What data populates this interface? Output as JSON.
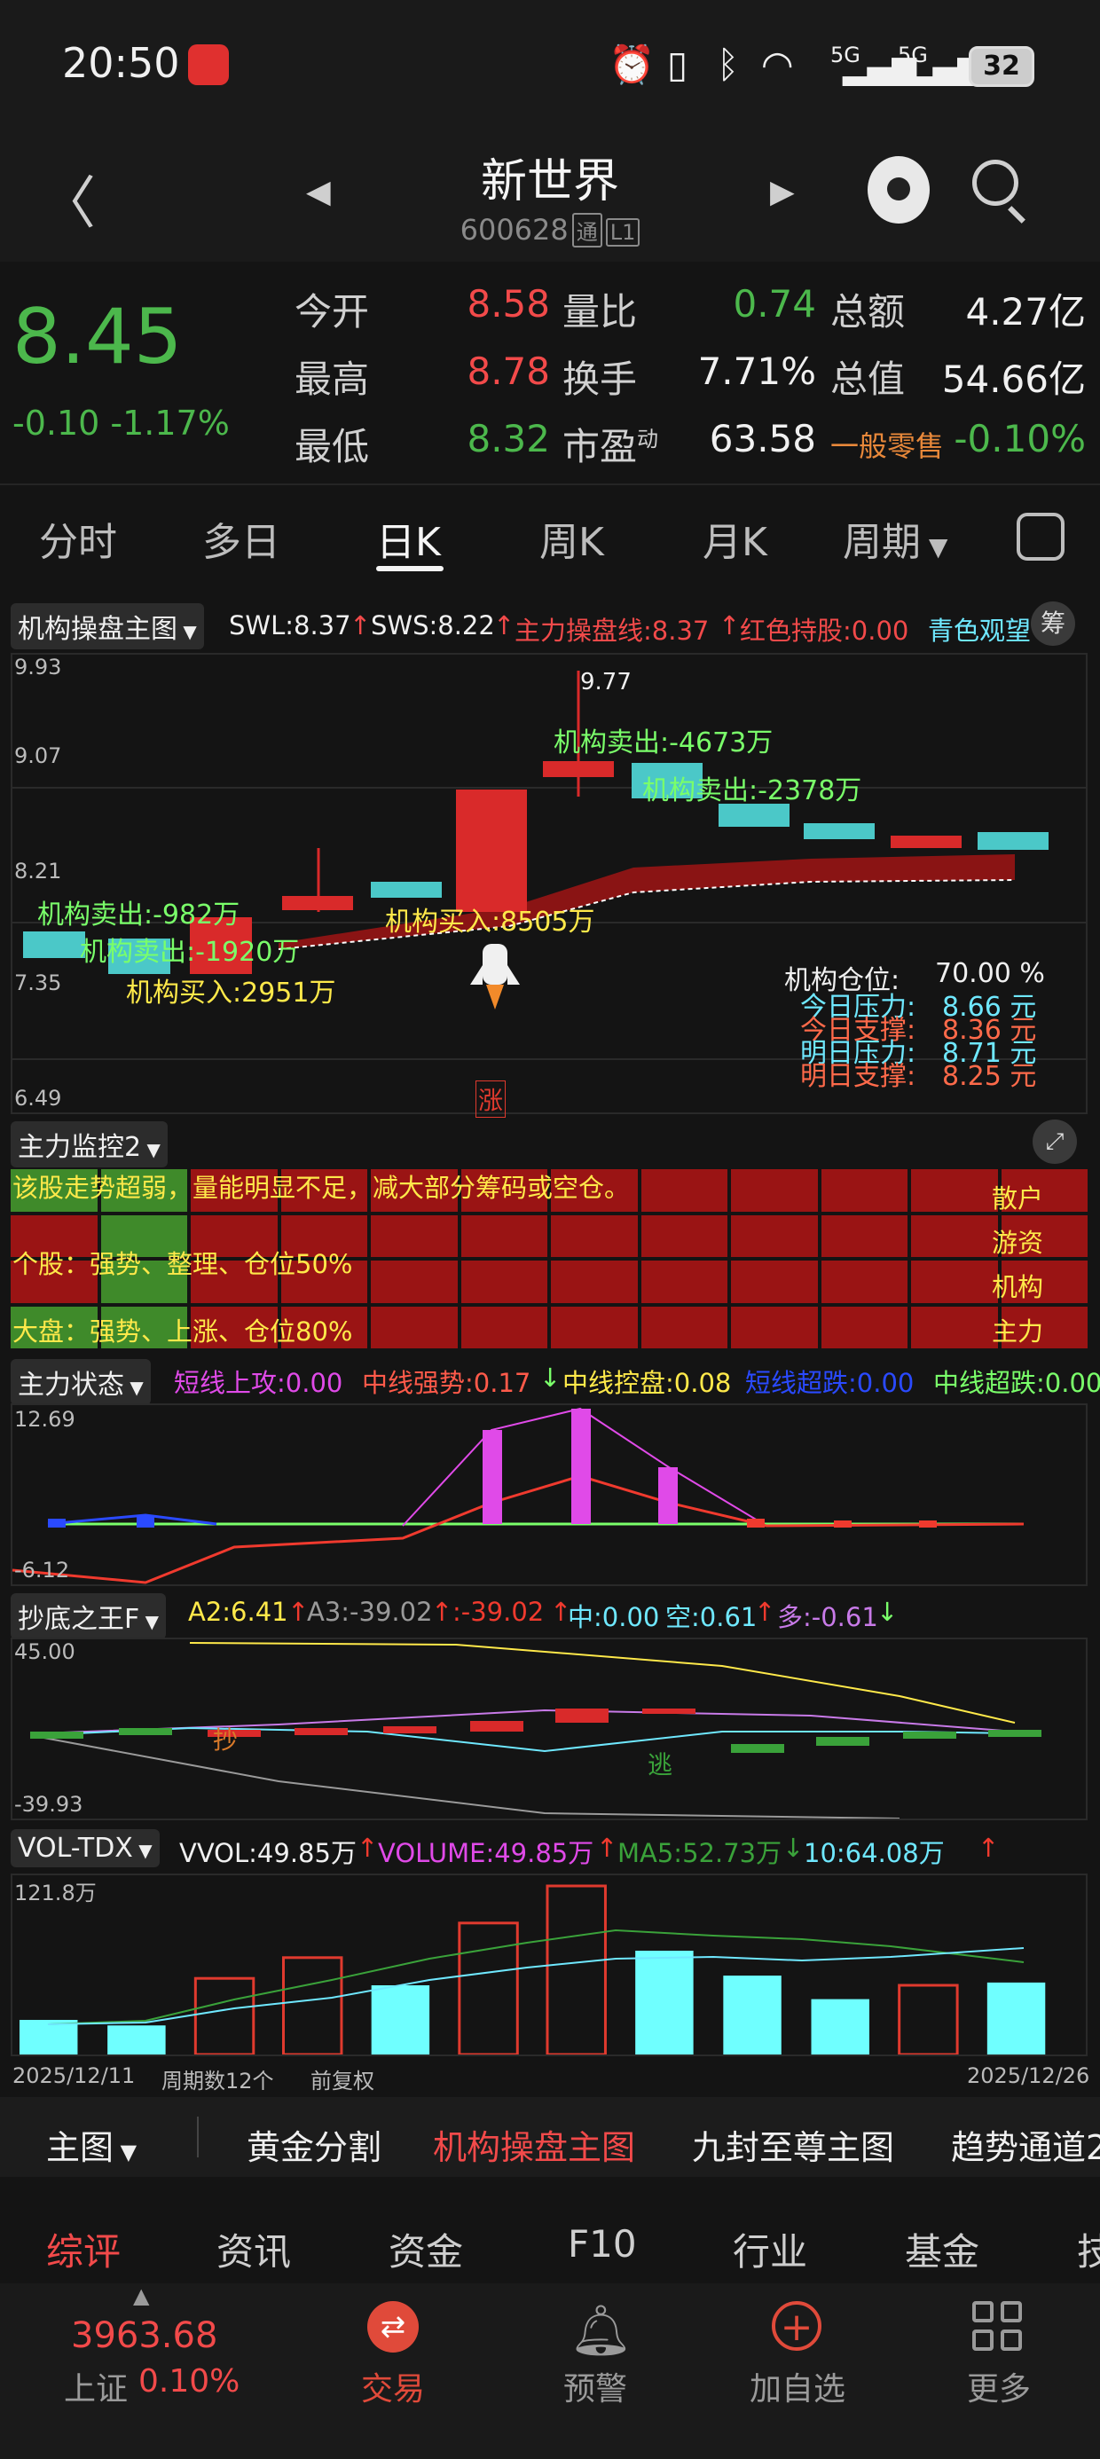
{
  "status_bar": {
    "time": "20:50",
    "network_a": "5G",
    "network_b": "5G",
    "battery": "32"
  },
  "header": {
    "stock_name": "新世界",
    "stock_code": "600628",
    "tag_tong": "通",
    "tag_l1": "L1"
  },
  "quote": {
    "price": "8.45",
    "change": "-0.10 -1.17%",
    "rows": [
      {
        "l1": "今开",
        "v1": "8.58",
        "l2": "量比",
        "v2": "0.74",
        "l3": "总额",
        "v3": "4.27亿"
      },
      {
        "l1": "最高",
        "v1": "8.78",
        "l2": "换手",
        "v2": "7.71%",
        "l3": "总值",
        "v3": "54.66亿"
      },
      {
        "l1": "最低",
        "v1": "8.32",
        "l2": "市盈",
        "l2_sup": "动",
        "v2": "63.58",
        "l3": "一般零售",
        "v3": "-0.10%"
      }
    ]
  },
  "tabs": [
    "分时",
    "多日",
    "日K",
    "周K",
    "月K",
    "周期"
  ],
  "main_chart": {
    "name": "机构操盘主图",
    "indicators": {
      "swl": "SWL:8.37",
      "sws": "SWS:8.22",
      "zl": "主力操盘线:8.37",
      "hs": "红色持股:0.00",
      "qs": "青色观望"
    },
    "chip_button": "筹",
    "y_ticks": [
      "9.93",
      "9.07",
      "8.21",
      "7.35",
      "6.49"
    ],
    "high_label": "9.77",
    "annotations": [
      "机构卖出:-4673万",
      "机构卖出:-2378万",
      "机构卖出:-982万",
      "机构卖出:-1920万",
      "机构买入:2951万",
      "机构买入:8505万"
    ],
    "limit_up_mark": "涨",
    "position": {
      "label": "机构仓位:",
      "value": "70.00 %"
    },
    "levels": [
      {
        "label": "今日压力:",
        "value": "8.66 元"
      },
      {
        "label": "今日支撑:",
        "value": "8.36 元"
      },
      {
        "label": "明日压力:",
        "value": "8.71 元"
      },
      {
        "label": "明日支撑:",
        "value": "8.25 元"
      }
    ]
  },
  "monitor": {
    "name": "主力监控2",
    "line1": "该股走势超弱，量能明显不足，减大部分筹码或空仓。",
    "line2": "个股：强势、整理、仓位50%",
    "line3": "大盘：强势、上涨、仓位80%",
    "side_labels": [
      "散户",
      "游资",
      "机构",
      "主力"
    ]
  },
  "state_panel": {
    "name": "主力状态",
    "values": {
      "a": "短线上攻:0.00",
      "b": "中线强势:0.17",
      "c": "中线控盘:0.08",
      "d": "短线超跌:0.00",
      "e": "中线超跌:0.00"
    },
    "y_top": "12.69",
    "y_bottom": "-6.12"
  },
  "bottom_panel": {
    "name": "抄底之王F",
    "values": {
      "a2": "A2:6.41",
      "a3": "A3:-39.02",
      "c": ":-39.02",
      "z": "中:0.00",
      "k": "空:0.61",
      "d": "多:-0.61"
    },
    "y_top": "45.00",
    "y_bottom": "-39.93",
    "mark_buy": "抄",
    "mark_escape": "逃"
  },
  "volume_panel": {
    "name": "VOL-TDX",
    "values": {
      "vvol": "VVOL:49.85万",
      "volume": "VOLUME:49.85万",
      "ma5": "MA5:52.73万",
      "ma10": "10:64.08万"
    },
    "y_top": "121.8万",
    "date_start": "2025/12/11",
    "periods": "周期数12个",
    "adjust": "前复权",
    "date_end": "2025/12/26"
  },
  "chart_data": {
    "type": "bar",
    "title": "VOL-TDX",
    "categories": [
      "1",
      "2",
      "3",
      "4",
      "5",
      "6",
      "7",
      "8",
      "9",
      "10",
      "11",
      "12"
    ],
    "series": [
      {
        "name": "VOLUME",
        "values": [
          25,
          21,
          55,
          70,
          50,
          95,
          121.8,
          75,
          57,
          40,
          50,
          52
        ]
      }
    ],
    "ylim": [
      0,
      121.8
    ],
    "colors": [
      "#6fffff",
      "#6fffff",
      "#e03a2e",
      "#e03a2e",
      "#6fffff",
      "#e03a2e",
      "#e03a2e",
      "#6fffff",
      "#6fffff",
      "#6fffff",
      "#e03a2e",
      "#6fffff"
    ]
  },
  "bottom_tabs": {
    "main": "主图",
    "items": [
      "黄金分割",
      "机构操盘主图",
      "九封至尊主图",
      "趋势通道2"
    ]
  },
  "section_tabs": [
    "综评",
    "资讯",
    "资金",
    "F10",
    "行业",
    "基金",
    "技"
  ],
  "bottom_nav": {
    "index_value": "3963.68",
    "index_name": "上证",
    "index_change": "0.10%",
    "items": [
      "交易",
      "预警",
      "加自选",
      "更多"
    ]
  }
}
